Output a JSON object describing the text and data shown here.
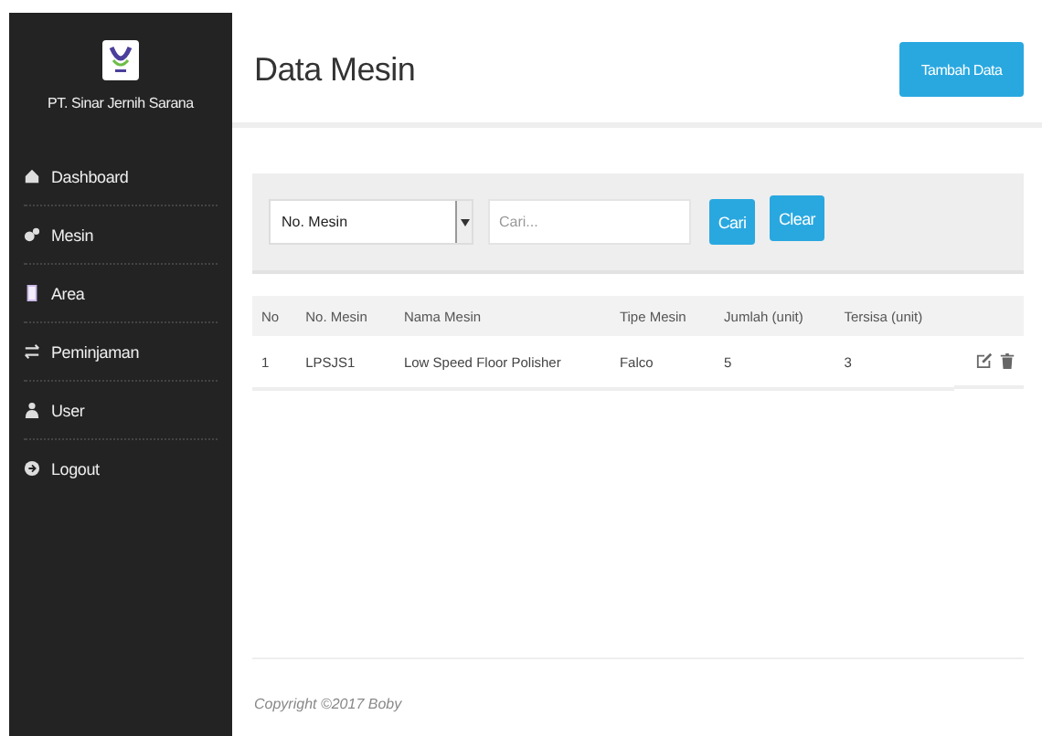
{
  "sidebar": {
    "company": "PT. Sinar Jernih Sarana",
    "items": [
      {
        "label": "Dashboard",
        "selected": false
      },
      {
        "label": "Mesin",
        "selected": false
      },
      {
        "label": "Area",
        "selected": false
      },
      {
        "label": "Peminjaman",
        "selected": false
      },
      {
        "label": "User",
        "selected": false
      },
      {
        "label": "Logout",
        "selected": false
      }
    ]
  },
  "header": {
    "title": "Data Mesin",
    "add_button": "Tambah Data"
  },
  "filter": {
    "select": "No. Mesin",
    "search": {
      "placeholder": "Cari..."
    },
    "search_button": "Cari",
    "clear_button": "Clear"
  },
  "table": {
    "columns": [
      "No",
      "No. Mesin",
      "Nama Mesin",
      "Tipe Mesin",
      "Jumlah (unit)",
      "Tersisa (unit)"
    ],
    "rows": [
      [
        "1",
        "LPSJS1",
        "Low Speed Floor Polisher",
        "Falco",
        "5",
        "3"
      ]
    ]
  },
  "footer": "Copyright ©2017 Boby"
}
